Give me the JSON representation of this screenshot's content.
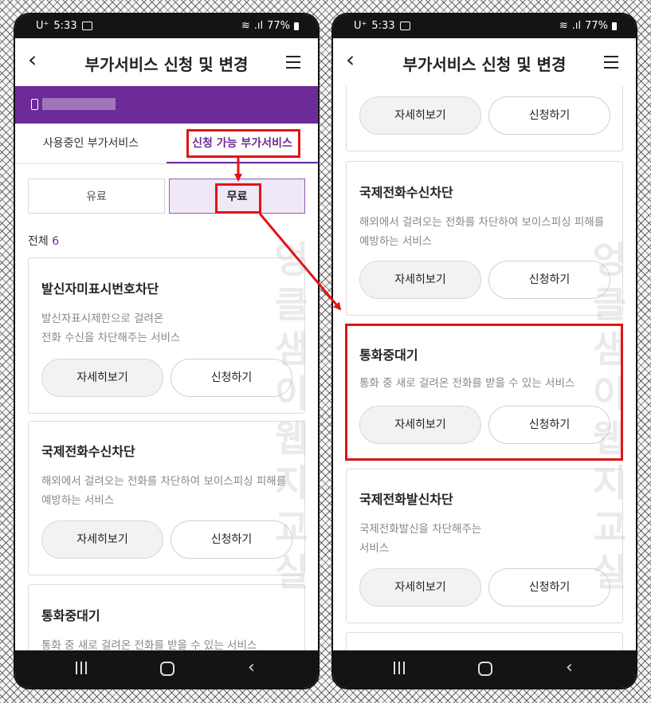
{
  "status": {
    "carrier": "U⁺",
    "time": "5:33",
    "battery": "77%"
  },
  "appbar": {
    "back_icon": "back-arrow-icon",
    "title": "부가서비스 신청 및 변경",
    "menu_icon": "hamburger-menu-icon"
  },
  "tabs": [
    {
      "label": "사용중인 부가서비스"
    },
    {
      "label": "신청 가능 부가서비스"
    }
  ],
  "segments": [
    {
      "label": "유료"
    },
    {
      "label": "무료"
    }
  ],
  "total": {
    "label": "전체",
    "count": "6"
  },
  "cards": {
    "c1": {
      "title": "발신자미표시번호차단",
      "desc": "발신자표시제한으로 걸려온\n전화 수신을 차단해주는 서비스"
    },
    "c2": {
      "title": "국제전화수신차단",
      "desc": "해외에서 걸려오는 전화를 차단하여 보이스피싱 피해를\n예방하는 서비스"
    },
    "c3": {
      "title": "통화중대기",
      "desc": "통화 중 새로 걸려온 전화를 받을 수 있는 서비스"
    },
    "c4": {
      "title": "국제전화발신차단",
      "desc": "국제전화발신을 차단해주는\n서비스"
    }
  },
  "buttons": {
    "detail": "자세히보기",
    "apply": "신청하기"
  },
  "watermark": "엉클샘이웹지교실",
  "colors": {
    "accent": "#6d2b98",
    "highlight_red": "#e01515"
  }
}
